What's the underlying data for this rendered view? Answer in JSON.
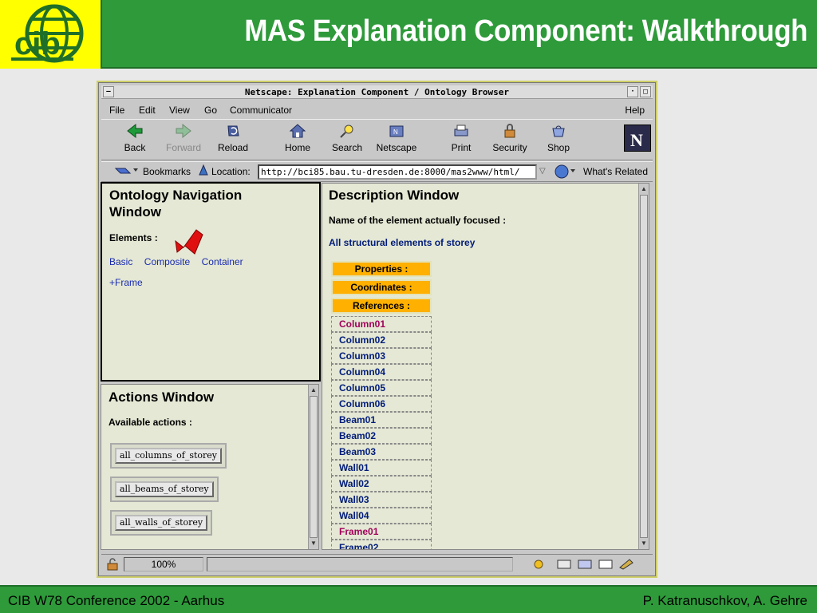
{
  "slide": {
    "title": "MAS Explanation Component: Walkthrough",
    "footer_left": "CIB W78 Conference 2002 - Aarhus",
    "footer_right": "P. Katranuschkov, A. Gehre",
    "logo_text": "cib"
  },
  "window": {
    "title": "Netscape: Explanation Component / Ontology Browser",
    "menu": [
      "File",
      "Edit",
      "View",
      "Go",
      "Communicator",
      "Help"
    ],
    "toolbar": [
      {
        "label": "Back",
        "icon": "back-arrow-icon",
        "enabled": true
      },
      {
        "label": "Forward",
        "icon": "forward-arrow-icon",
        "enabled": false
      },
      {
        "label": "Reload",
        "icon": "reload-icon",
        "enabled": true
      },
      {
        "label": "Home",
        "icon": "home-icon",
        "enabled": true
      },
      {
        "label": "Search",
        "icon": "search-icon",
        "enabled": true
      },
      {
        "label": "Netscape",
        "icon": "netscape-icon",
        "enabled": true
      },
      {
        "label": "Print",
        "icon": "print-icon",
        "enabled": true
      },
      {
        "label": "Security",
        "icon": "lock-icon",
        "enabled": true
      },
      {
        "label": "Shop",
        "icon": "shop-icon",
        "enabled": true
      }
    ],
    "bookmarks_label": "Bookmarks",
    "location_label": "Location:",
    "location_url": "http://bci85.bau.tu-dresden.de:8000/mas2www/html/",
    "whats_related": "What's Related",
    "zoom": "100%"
  },
  "ontology": {
    "heading": "Ontology Navigation Window",
    "elements_label": "Elements :",
    "links": [
      "Basic",
      "Composite",
      "Container"
    ],
    "frame_link": "+Frame"
  },
  "actions": {
    "heading": "Actions Window",
    "available_label": "Available actions :",
    "buttons": [
      "all_columns_of_storey",
      "all_beams_of_storey",
      "all_walls_of_storey"
    ]
  },
  "description": {
    "heading": "Description Window",
    "focused_label": "Name of the element actually focused :",
    "focused_value": "All structural elements of storey",
    "sections": [
      "Properties :",
      "Coordinates :",
      "References :"
    ],
    "references": [
      {
        "name": "Column01",
        "visited": true
      },
      {
        "name": "Column02",
        "visited": false
      },
      {
        "name": "Column03",
        "visited": false
      },
      {
        "name": "Column04",
        "visited": false
      },
      {
        "name": "Column05",
        "visited": false
      },
      {
        "name": "Column06",
        "visited": false
      },
      {
        "name": "Beam01",
        "visited": false
      },
      {
        "name": "Beam02",
        "visited": false
      },
      {
        "name": "Beam03",
        "visited": false
      },
      {
        "name": "Wall01",
        "visited": false
      },
      {
        "name": "Wall02",
        "visited": false
      },
      {
        "name": "Wall03",
        "visited": false
      },
      {
        "name": "Wall04",
        "visited": false
      },
      {
        "name": "Frame01",
        "visited": true
      },
      {
        "name": "Frame02",
        "visited": false
      }
    ]
  },
  "colors": {
    "slide_green": "#2e9a3a",
    "logo_yellow": "#ffff00",
    "frame_bg": "#e4e8d4",
    "orange_cell": "#ffb000",
    "link_blue": "#1a2bb0",
    "visited_magenta": "#a0005a",
    "pointer_red": "#e01010"
  }
}
